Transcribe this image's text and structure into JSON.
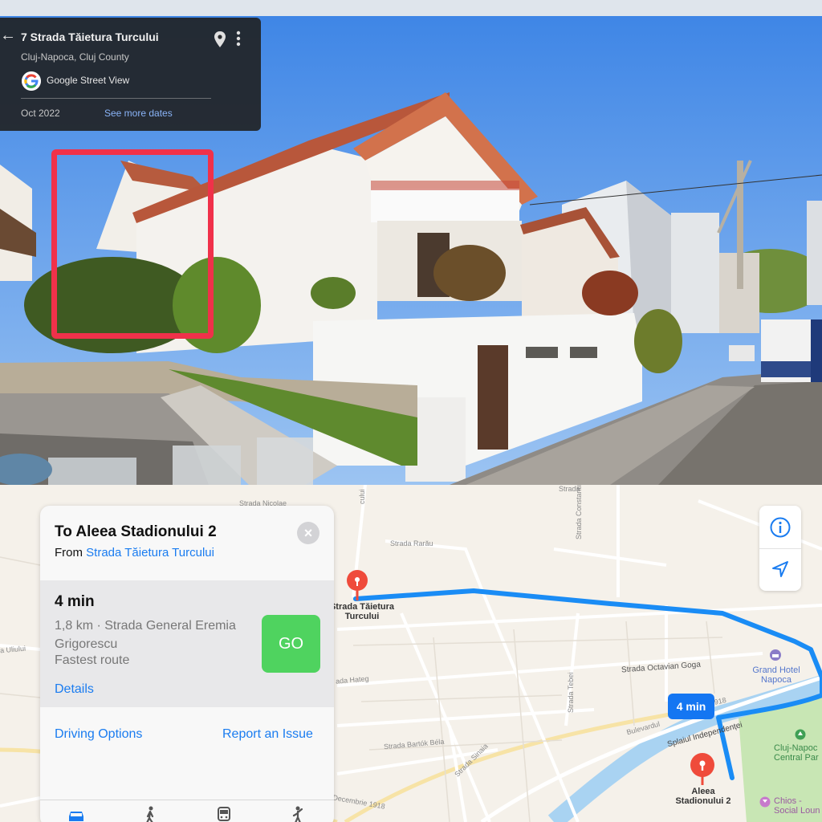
{
  "street_view": {
    "title": "7 Strada Tăietura Turcului",
    "subtitle": "Cluj-Napoca, Cluj County",
    "provider": "Google Street View",
    "date": "Oct 2022",
    "see_more_dates": "See more dates",
    "back_icon": "back-arrow-icon",
    "pin_icon": "location-pin-icon",
    "more_icon": "more-vert-icon",
    "highlight_color": "#f0314a"
  },
  "map": {
    "labels": {
      "strada_nicolae": "Strada Nicolae",
      "strada_rarau": "Strada Rarău",
      "strada_top": "Strada",
      "strada_constantin": "Strada Constantin A. Rosetti",
      "strada_octavian": "Strada Octavian Goga",
      "strada_hateg": "ada Hateg",
      "strada_tebei": "Strada Tebei",
      "strada_bartok": "Strada Bartók Béla",
      "strada_sinaia": "Strada Sinaia",
      "bulevardul": "Bulevardul",
      "splaiul": "Splaiul Independenței",
      "decembrie": "Decembrie 1918",
      "decembrie_top": "embrie 1918",
      "uliului": "a Uliului",
      "origin_line1": "Strada Tăietura",
      "origin_line2": "Turcului",
      "grand_hotel_line1": "Grand Hotel",
      "grand_hotel_line2": "Napoca",
      "park_line1": "Cluj-Napoc",
      "park_line2": "Central Par",
      "chios_line1": "Chios -",
      "chios_line2": "Social Loun",
      "dest_line1": "Aleea",
      "dest_line2": "Stadionului 2",
      "vertical_cului": "cului"
    },
    "route_badge": "4 min",
    "route_color": "#1a8cf5",
    "controls": {
      "info_icon": "info-icon",
      "location_icon": "location-arrow-icon"
    }
  },
  "directions": {
    "title": "To Aleea Stadionului 2",
    "from_prefix": "From",
    "from_place": "Strada Tăietura Turcului",
    "time": "4 min",
    "description": "1,8 km · Strada General Eremia Grigorescu",
    "route_type": "Fastest route",
    "details": "Details",
    "go": "GO",
    "driving_options": "Driving Options",
    "report_issue": "Report an Issue",
    "tabs": [
      "car-icon",
      "walk-icon",
      "transit-icon",
      "ride-icon"
    ]
  }
}
